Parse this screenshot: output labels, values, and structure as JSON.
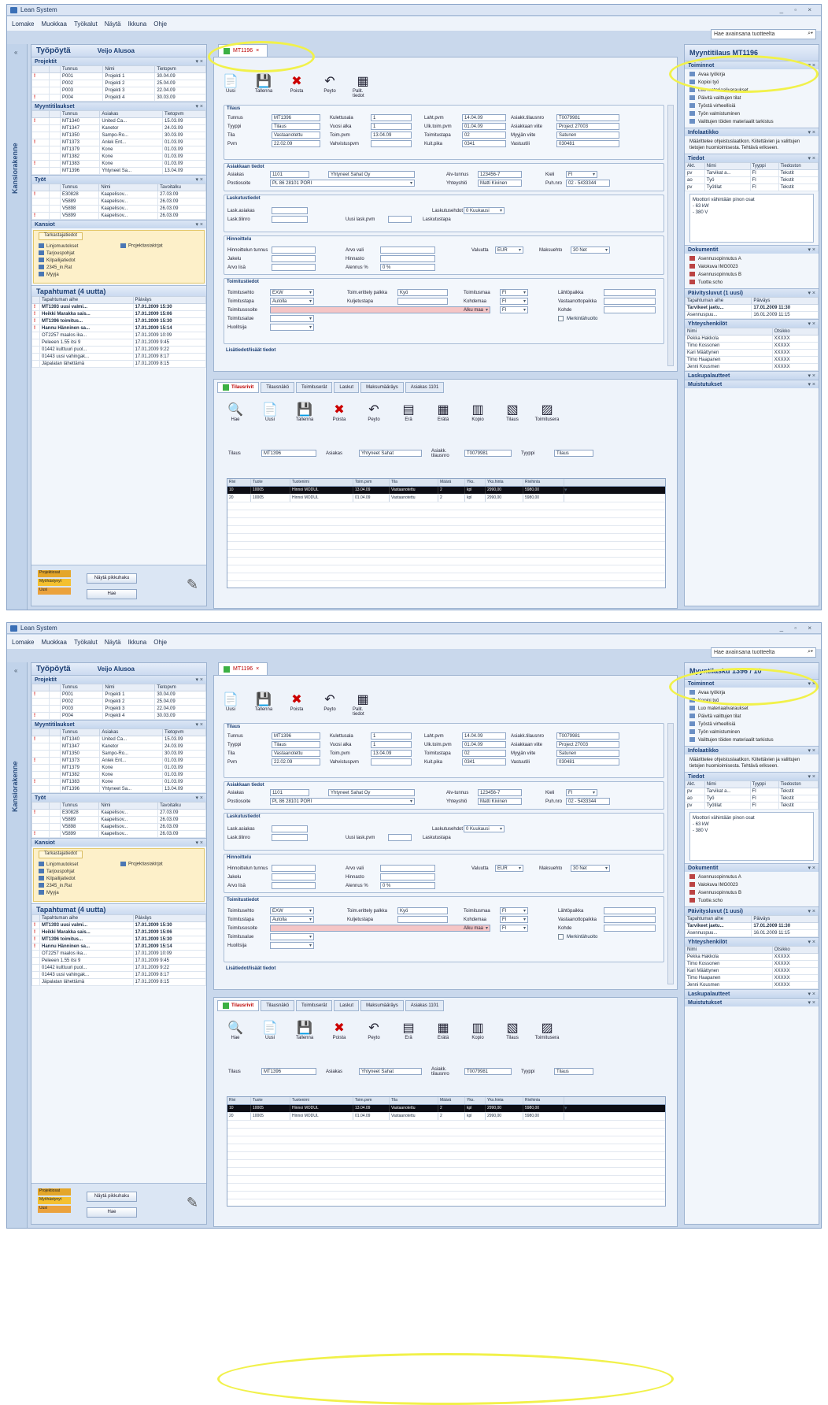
{
  "shots": [
    {
      "window_title": "Lean System",
      "doc_tab": "MT1196",
      "right_title": "Myyntitilaus MT1196"
    },
    {
      "window_title": "Lean System",
      "doc_tab": "MT1196",
      "right_title": "Myyntilasku 1396 / 10"
    }
  ],
  "menu": [
    "Lomake",
    "Muokkaa",
    "Työkalut",
    "Näytä",
    "Ikkuna",
    "Ohje"
  ],
  "help_placeholder": "Hae avainsana tuotteelta",
  "vstrip_label": "Kansiorakenne",
  "left": {
    "title": "Työpöytä",
    "user": "Veijo Alusoa",
    "projects_title": "Projektit",
    "projects_cols": [
      "Tunnus",
      "Nimi",
      "Tietopvm"
    ],
    "projects": [
      [
        "P001",
        "Projekti 1",
        "30.04.09"
      ],
      [
        "P002",
        "Projekti 2",
        "25.04.09"
      ],
      [
        "P003",
        "Projekti 3",
        "22.04.09"
      ],
      [
        "P004",
        "Projekti 4",
        "30.03.09"
      ]
    ],
    "sales_title": "Myyntitilaukset",
    "sales_cols": [
      "Tunnus",
      "Asiakas",
      "Tietopvm"
    ],
    "sales": [
      [
        "MT1340",
        "United Ca...",
        "15.03.09"
      ],
      [
        "MT1347",
        "Kanetor",
        "24.03.09"
      ],
      [
        "MT1350",
        "Sampo-Ro...",
        "30.03.09"
      ],
      [
        "MT1373",
        "Anlek Ent...",
        "01.03.09"
      ],
      [
        "MT1379",
        "Kone",
        "01.03.09"
      ],
      [
        "MT1382",
        "Kone",
        "01.03.09"
      ],
      [
        "MT1383",
        "Kone",
        "01.03.09"
      ],
      [
        "MT1396",
        "Yhtyneet Sa...",
        "13.04.09"
      ]
    ],
    "jobs_title": "Työt",
    "jobs_cols": [
      "Tunnus",
      "Nimi",
      "Tavoitalku"
    ],
    "jobs": [
      [
        "E30828",
        "Kaapelisov...",
        "27.03.09"
      ],
      [
        "V5889",
        "Kaapelisov...",
        "26.03.09"
      ],
      [
        "V5898",
        "Kaapelisov...",
        "26.03.09"
      ],
      [
        "V5899",
        "Kaapelisov...",
        "26.03.09"
      ]
    ],
    "folders_title": "Kansiot",
    "folders_tab": "Tarkastajatiedot",
    "folders": [
      "Linjomuutokset",
      "Tarjouspohjat",
      "Kilpailijatiedot",
      "2345_in.Rat",
      "Myyja"
    ],
    "folders2": "Projektiasiakirjat",
    "events_title": "Tapahtumat (4 uutta)",
    "events_cols": [
      "Tapahtuman aihe",
      "Päiväys"
    ],
    "events": [
      [
        "MT1393 uusi valmi...",
        "17.01.2009 15:30"
      ],
      [
        "Heikki Marakka sais...",
        "17.01.2009 15:06"
      ],
      [
        "MT1396 toimitus...",
        "17.01.2009 15:30"
      ],
      [
        "Hannu Hänninen sa...",
        "17.01.2009 15:14"
      ],
      [
        "OT2257 maalos ika...",
        "17.01.2009 10:09"
      ],
      [
        "Peleeen 1.55 itsi 9",
        "17.01.2009 9:45"
      ],
      [
        "01442 kulttuuri puol...",
        "17.01.2009 9:22"
      ],
      [
        "01443 uusi vahingak...",
        "17.01.2009 8:17"
      ],
      [
        "Jäpalatan lähettämä",
        "17.01.2009 8:15"
      ]
    ],
    "legend": [
      "Projektiosat",
      "Myöhästynyt",
      "Uusi"
    ],
    "btn_show": "Näytä pikkuhaku",
    "btn_find": "Hae"
  },
  "toolbar": [
    "Uusi",
    "Tallenna",
    "Poista",
    "Peyto",
    "Palit. tiedot"
  ],
  "form": {
    "g1": "Tilaus",
    "g1_rows": [
      [
        "Tunnus",
        "MT1396"
      ],
      [
        "Tyyppi",
        "Tilaus"
      ],
      [
        "Tila",
        "Vastaanotettu"
      ],
      [
        "Pvm",
        "22.02.09"
      ]
    ],
    "g1_mid": [
      [
        "Kulettusala",
        "1"
      ],
      [
        "Vuosi alka",
        "1"
      ],
      [
        "Toim.pvm",
        "13.04.09"
      ],
      [
        "Vahvistuspvm",
        ""
      ]
    ],
    "g1_r": [
      [
        "Laht.pvm",
        "14.04.09"
      ],
      [
        "Ulk.toim.pvm",
        "01.04.09"
      ],
      [
        "Toimitustapa",
        "02"
      ],
      [
        "Kuit.pika",
        "0341"
      ]
    ],
    "g1_rr": [
      [
        "Asiakk.tilausnro",
        "T0079981"
      ],
      [
        "Asiakkaan viite",
        "Project 27003"
      ],
      [
        "Myyjän viite",
        "Satunen"
      ],
      [
        "Vastuutili",
        "030481"
      ]
    ],
    "g2": "Asiakkaan tiedot",
    "asiakas_label": "Asiakas",
    "asiakas": "1101",
    "asiakas_name": "Yhtyneet Sahat Oy",
    "postiosoite_label": "Postiosoite",
    "postiosoite": "PL 86 28101 PORI",
    "ytunnus_label": "Alv-tunnus",
    "ytunnus": "123456-7",
    "kieli_label": "Kieli",
    "kieli": "FI",
    "yhteys_label": "Yhteyshlö",
    "yhteys": "Matti Kivinen",
    "puh_label": "Puh.nro",
    "puh": "02 - 5433344",
    "g3": "Laskutustiedot",
    "g3_rows": [
      [
        "Lask.asiakas",
        ""
      ],
      [
        "Lask.tilinro",
        ""
      ]
    ],
    "uusi_label": "Uusi lask.pvm",
    "ehdot_label": "Laskutusehdot",
    "ehdot": "0 Kuukausi",
    "lasku_label": "Laskutustapa",
    "g4": "Hinnoittelu",
    "g4_rows": [
      [
        "Hinnoittelun tunnus",
        ""
      ],
      [
        "Jakelu",
        ""
      ],
      [
        "Arvo lisä",
        ""
      ]
    ],
    "g4_mid": [
      [
        "Arvo vali",
        ""
      ],
      [
        "Hinnasto",
        ""
      ],
      [
        "Alennus %",
        "0 %"
      ]
    ],
    "valuutta": "EUR",
    "kurssi_label": "Valuutta",
    "maksuehto_label": "Maksuehto",
    "maksuehto": "30 Net",
    "g5": "Toimitustiedot",
    "g5_rows": [
      [
        "Toimitusehto",
        "EXW"
      ],
      [
        "Toimitustapa",
        "Autolla"
      ],
      [
        "Toimitusosoite",
        ""
      ],
      [
        "Toimitusalue",
        ""
      ],
      [
        "Huolitsija",
        ""
      ]
    ],
    "toimitus_mid": [
      "Toim.erittely palkka",
      "Kuljetustapa"
    ],
    "toimitus_mid_val": "Kyö",
    "toim_r": [
      "Toimitusmaa",
      "Kohdemaa",
      "Alku maa"
    ],
    "toim_r_val": "FI",
    "toim_rr": [
      "Lähtöpaikka",
      "Vastaanottopaikka",
      "Kohde"
    ],
    "lisatiedot": "Lisätiedot/lisäät tiedot",
    "merkki": "Merkintähuolto"
  },
  "detail": {
    "tabs": [
      "Tilausrivit",
      "Tilausnäkö",
      "Toimituserät",
      "Laskut",
      "Maksumääräys",
      "Asiakas 1101"
    ],
    "toolbar": [
      "Hae",
      "Uusi",
      "Tallenna",
      "Poista",
      "Peyto",
      "Erä",
      "Erätä",
      "Kopio",
      "Tilaus",
      "Toimitusera"
    ],
    "info_labels": [
      "Tilaus",
      "Asiakas",
      "Asiakk. tilausnro",
      "Tyyppi"
    ],
    "info_values": [
      "MT1396",
      "Yhtyneet Sahat",
      "T0079981",
      "Tilaus"
    ],
    "cols": [
      "Rivi",
      "Tuote",
      "Tuotenimi",
      "Toim.pvm",
      "Tila",
      "Määrä",
      "Yks.",
      "Yks.hinta",
      "Rivihinta"
    ],
    "rows": [
      [
        "10",
        "10005",
        "Hinnoi MODUL",
        "13.04.09",
        "Vastaanotettu",
        "2",
        "kpl",
        "2990,00",
        "5980,00"
      ],
      [
        "20",
        "10005",
        "Hinnoi MODUL",
        "01.04.09",
        "Vastaanotettu",
        "2",
        "kpl",
        "2990,00",
        "5980,00"
      ]
    ]
  },
  "right": {
    "tb": "Myyntitilauksen tehtävät",
    "section_tasks": "Toiminnot",
    "tasks": [
      "Avaa työkirja",
      "Kopioi työ",
      "Luo materiaalivaraukset",
      "Päivitä valittujen tilat",
      "Työstä virheellisiä",
      "Työn valmistuminen",
      "Valittujen töiden materiaalit tarkistus"
    ],
    "section_info": "Infolaatikko",
    "info": "Määrittelee ohjeistuslaatikon. Kiitettävien ja valittujen tietojen huomioimisesta. Tehtävä erikseen.",
    "section_files": "Tiedot",
    "files_cols": [
      "Akt.",
      "Nimi",
      "Tyyppi",
      "Tiedoston"
    ],
    "files": [
      [
        "pv",
        "Tarvikat a...",
        "FI",
        "Tekstit"
      ],
      [
        "ao",
        "Työ",
        "FI",
        "Tekstit"
      ],
      [
        "pv",
        "Työtilat",
        "FI",
        "Tekstit"
      ]
    ],
    "note": "Moottori vähintään pinon osat\n- 63 kW\n- 380 V",
    "section_docs": "Dokumentit",
    "docs": [
      "Asennusopinnutus A",
      "Valokuva IMG0023",
      "Asennusopinnutus B",
      "Tuotte.scho"
    ],
    "section_events": "Päivitysluvut (1 uusi)",
    "events_cols": [
      "Tapahtuman aihe",
      "Päiväys"
    ],
    "events": [
      [
        "Tarvikeet jaetu...",
        "17.01.2009 11:30"
      ],
      [
        "Asennuspuu...",
        "16.01.2009 11:15"
      ]
    ],
    "section_contacts": "Yhteyshenkilöt",
    "contacts_cols": [
      "Nimi",
      "Otsikko"
    ],
    "contacts": [
      [
        "Pekka Hakkola",
        "XXXXX"
      ],
      [
        "Timo Kossonen",
        "XXXXX"
      ],
      [
        "Kari Määttynen",
        "XXXXX"
      ],
      [
        "Timo Haapanen",
        "XXXXX"
      ],
      [
        "Jenni Kousmen",
        "XXXXX"
      ]
    ],
    "s1": "Laskupalautteet",
    "s2": "Muistutukset"
  }
}
